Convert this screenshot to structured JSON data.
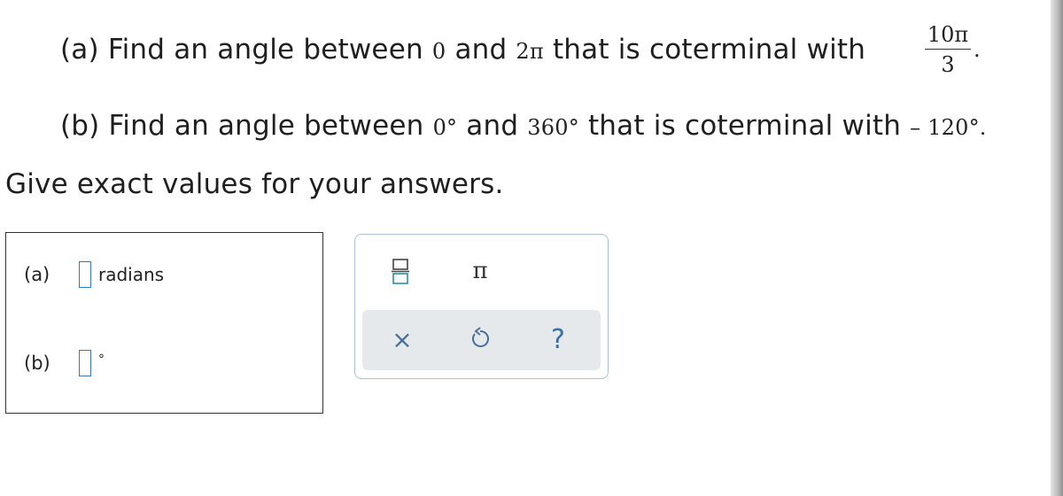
{
  "question": {
    "part_a": {
      "prefix": "(a) Find an angle between",
      "low": "0",
      "and": "and",
      "high": "2π",
      "suffix": "that is coterminal with",
      "fraction_numerator": "10π",
      "fraction_denominator": "3",
      "end": "."
    },
    "part_b": {
      "prefix": "(b) Find an angle between",
      "low": "0°",
      "and": "and",
      "high": "360°",
      "suffix": "that is coterminal with",
      "value": "– 120°."
    },
    "instruction": "Give exact values for your answers."
  },
  "answers": {
    "a": {
      "label": "(a)",
      "unit": "radians"
    },
    "b": {
      "label": "(b)",
      "unit": "°"
    }
  },
  "toolbar": {
    "pi_symbol": "π",
    "clear_symbol": "×",
    "help_symbol": "?",
    "icons": [
      "fraction-icon",
      "pi-icon",
      "clear-icon",
      "undo-icon",
      "help-icon"
    ]
  }
}
